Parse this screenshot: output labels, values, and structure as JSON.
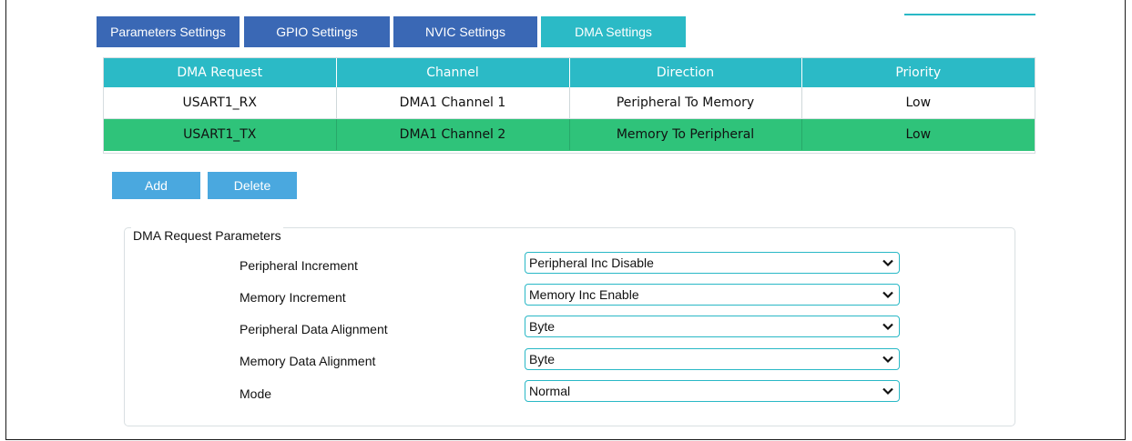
{
  "tabs": [
    {
      "label": "Parameters Settings",
      "active": false
    },
    {
      "label": "GPIO Settings",
      "active": false
    },
    {
      "label": "NVIC Settings",
      "active": false
    },
    {
      "label": "DMA Settings",
      "active": true
    }
  ],
  "table": {
    "columns": [
      "DMA Request",
      "Channel",
      "Direction",
      "Priority"
    ],
    "rows": [
      [
        "USART1_RX",
        "DMA1 Channel 1",
        "Peripheral To Memory",
        "Low"
      ],
      [
        "USART1_TX",
        "DMA1 Channel 2",
        "Memory To Peripheral",
        "Low"
      ]
    ],
    "selected_row": 1
  },
  "buttons": {
    "add": "Add",
    "delete": "Delete"
  },
  "params": {
    "group_title": "DMA Request Parameters",
    "fields": [
      {
        "label": "Peripheral Increment",
        "value": "Peripheral Inc Disable"
      },
      {
        "label": "Memory Increment",
        "value": "Memory Inc Enable"
      },
      {
        "label": "Peripheral Data Alignment",
        "value": "Byte"
      },
      {
        "label": "Memory Data Alignment",
        "value": "Byte"
      },
      {
        "label": "Mode",
        "value": "Normal"
      }
    ]
  },
  "colors": {
    "tab_inactive": "#3a68b5",
    "tab_active": "#2bbac6",
    "header": "#2bbac6",
    "selected_row": "#2fc37a",
    "button": "#4aa8df"
  },
  "icons": {
    "dropdown": "chevron-down-icon"
  }
}
